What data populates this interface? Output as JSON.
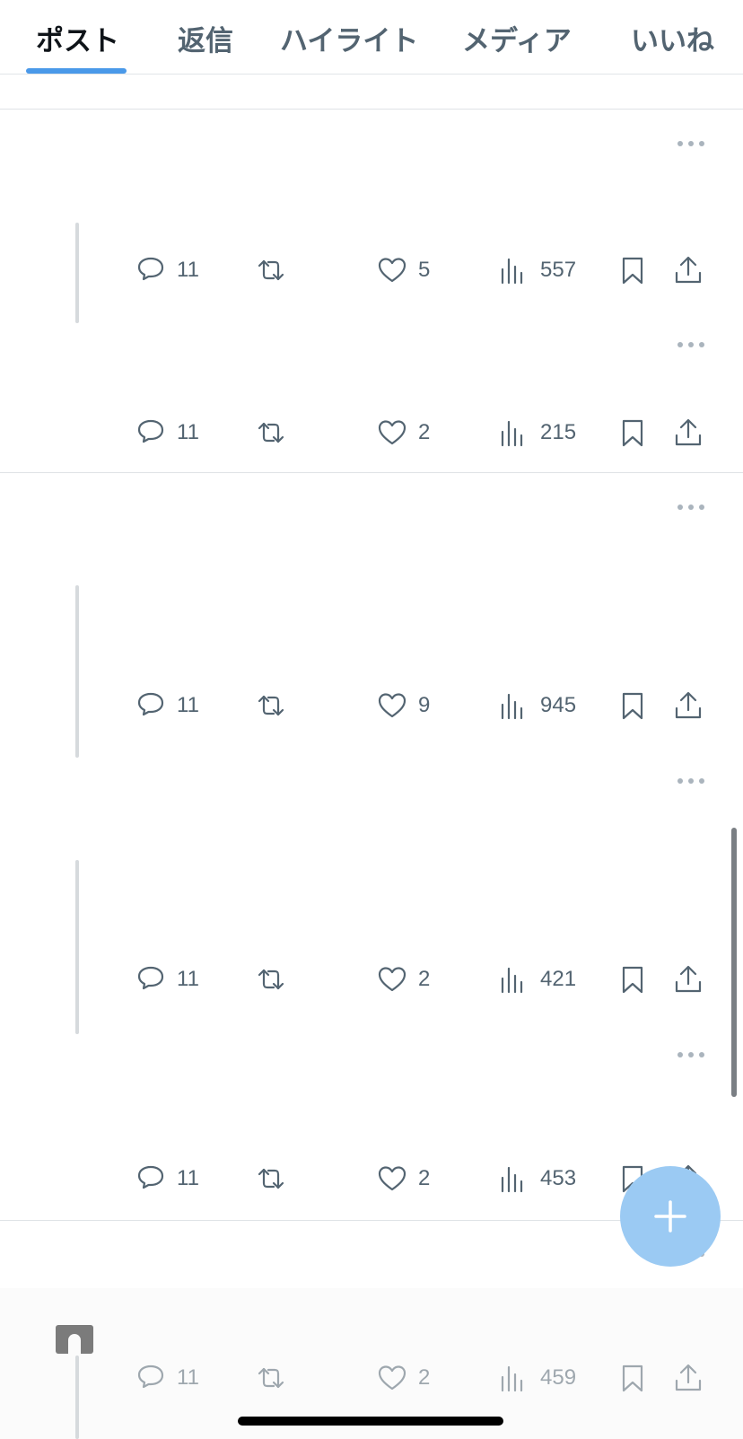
{
  "tabs": [
    {
      "label": "ポスト",
      "active": true
    },
    {
      "label": "返信",
      "active": false
    },
    {
      "label": "ハイライト",
      "active": false
    },
    {
      "label": "メディア",
      "active": false
    },
    {
      "label": "いいね",
      "active": false
    }
  ],
  "posts": [
    {
      "replies": "11",
      "likes": "5",
      "views": "557"
    },
    {
      "replies": "11",
      "likes": "2",
      "views": "215"
    },
    {
      "replies": "11",
      "likes": "9",
      "views": "945"
    },
    {
      "replies": "11",
      "likes": "2",
      "views": "421"
    },
    {
      "replies": "11",
      "likes": "2",
      "views": "453"
    },
    {
      "replies": "11",
      "likes": "2",
      "views": "459"
    }
  ],
  "fab": {
    "icon": "plus-icon"
  },
  "colors": {
    "accent": "#4a99e9",
    "fab": "#9bcaf3",
    "icon": "#536471"
  }
}
